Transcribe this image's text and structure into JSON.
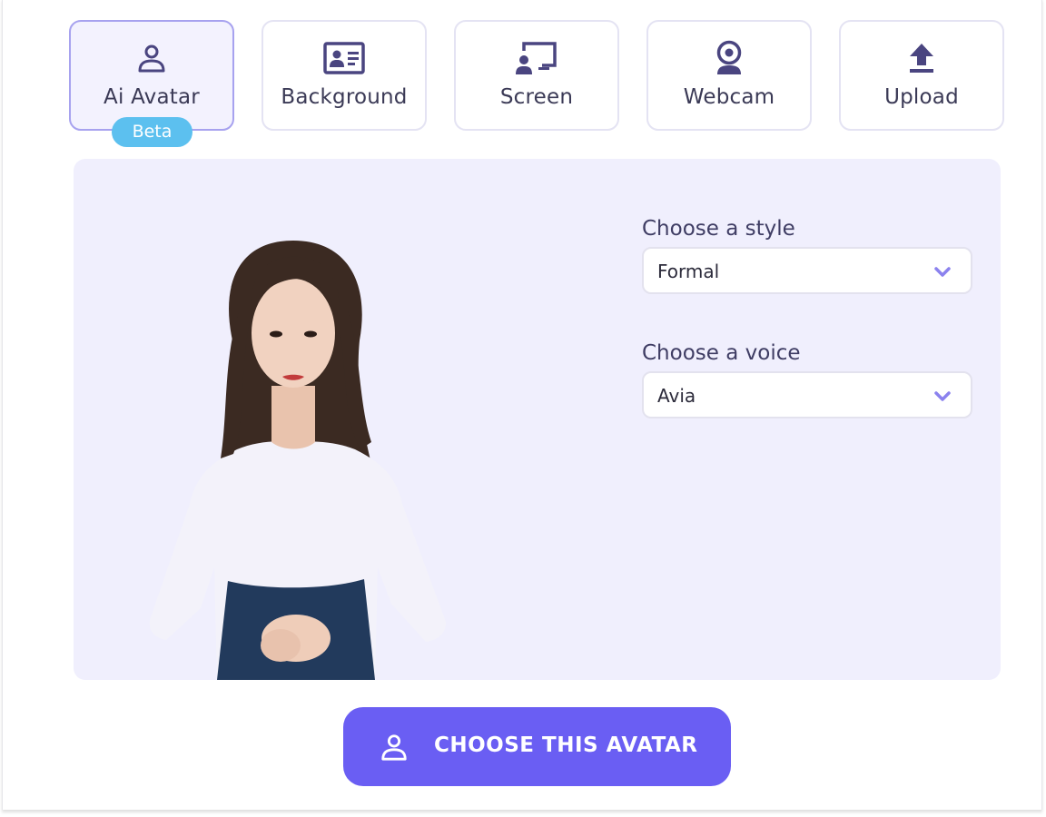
{
  "colors": {
    "accent": "#6a5ef3",
    "icon": "#4a4580",
    "panel_bg": "#f0effd",
    "badge": "#5cc0ef",
    "chevron": "#8b82ee"
  },
  "tabs": [
    {
      "label": "Ai Avatar",
      "icon": "user-icon",
      "active": true
    },
    {
      "label": "Background",
      "icon": "id-card-icon",
      "active": false
    },
    {
      "label": "Screen",
      "icon": "presenter-screen-icon",
      "active": false
    },
    {
      "label": "Webcam",
      "icon": "webcam-icon",
      "active": false
    },
    {
      "label": "Upload",
      "icon": "upload-icon",
      "active": false
    }
  ],
  "badge": {
    "label": "Beta"
  },
  "panel": {
    "style": {
      "label": "Choose a style",
      "value": "Formal"
    },
    "voice": {
      "label": "Choose a voice",
      "value": "Avia"
    }
  },
  "cta": {
    "label": "CHOOSE THIS AVATAR",
    "icon": "user-icon"
  }
}
